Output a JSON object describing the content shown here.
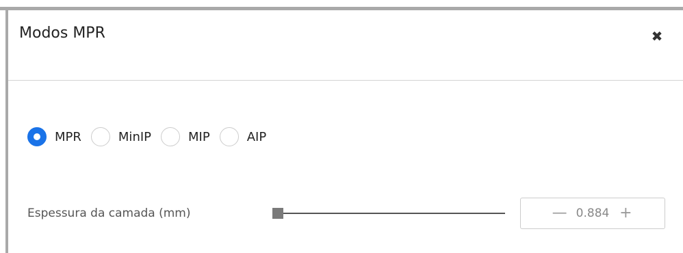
{
  "dialog": {
    "title": "Modos MPR",
    "close_icon": "close-icon"
  },
  "modes": {
    "options": [
      {
        "label": "MPR",
        "checked": true
      },
      {
        "label": "MinIP",
        "checked": false
      },
      {
        "label": "MIP",
        "checked": false
      },
      {
        "label": "AIP",
        "checked": false
      }
    ],
    "selected": "MPR"
  },
  "thickness": {
    "label": "Espessura da camada (mm)",
    "value": "0.884",
    "slider_fraction": 0,
    "decrement_symbol": "—",
    "increment_symbol": "+"
  },
  "colors": {
    "accent": "#1a73e8",
    "border": "#a9a9a9"
  }
}
